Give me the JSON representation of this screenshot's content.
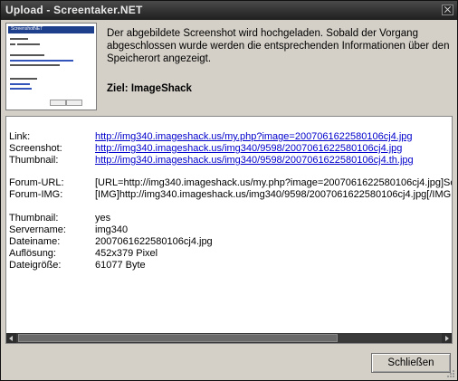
{
  "window": {
    "title": "Upload - Screentaker.NET"
  },
  "thumbnail": {
    "caption": "ScreenshotNET"
  },
  "description": "Der abgebildete Screenshot wird hochgeladen. Sobald der Vorgang abgeschlossen wurde werden die entsprechenden Informationen über den Speicherort angezeigt.",
  "target": "Ziel: ImageShack",
  "links": [
    {
      "label": "Link:",
      "value": "http://img340.imageshack.us/my.php?image=2007061622580106cj4.jpg"
    },
    {
      "label": "Screenshot:",
      "value": "http://img340.imageshack.us/img340/9598/2007061622580106cj4.jpg"
    },
    {
      "label": "Thumbnail:",
      "value": "http://img340.imageshack.us/img340/9598/2007061622580106cj4.th.jpg"
    }
  ],
  "forum": [
    {
      "label": "Forum-URL:",
      "value": "[URL=http://img340.imageshack.us/my.php?image=2007061622580106cj4.jpg]Sc"
    },
    {
      "label": "Forum-IMG:",
      "value": "[IMG]http://img340.imageshack.us/img340/9598/2007061622580106cj4.jpg[/IMG"
    }
  ],
  "info": [
    {
      "label": "Thumbnail:",
      "value": "yes"
    },
    {
      "label": "Servername:",
      "value": "img340"
    },
    {
      "label": "Dateiname:",
      "value": "2007061622580106cj4.jpg"
    },
    {
      "label": "Auflösung:",
      "value": "452x379 Pixel"
    },
    {
      "label": "Dateigröße:",
      "value": "61077 Byte"
    }
  ],
  "close_button": "Schließen"
}
